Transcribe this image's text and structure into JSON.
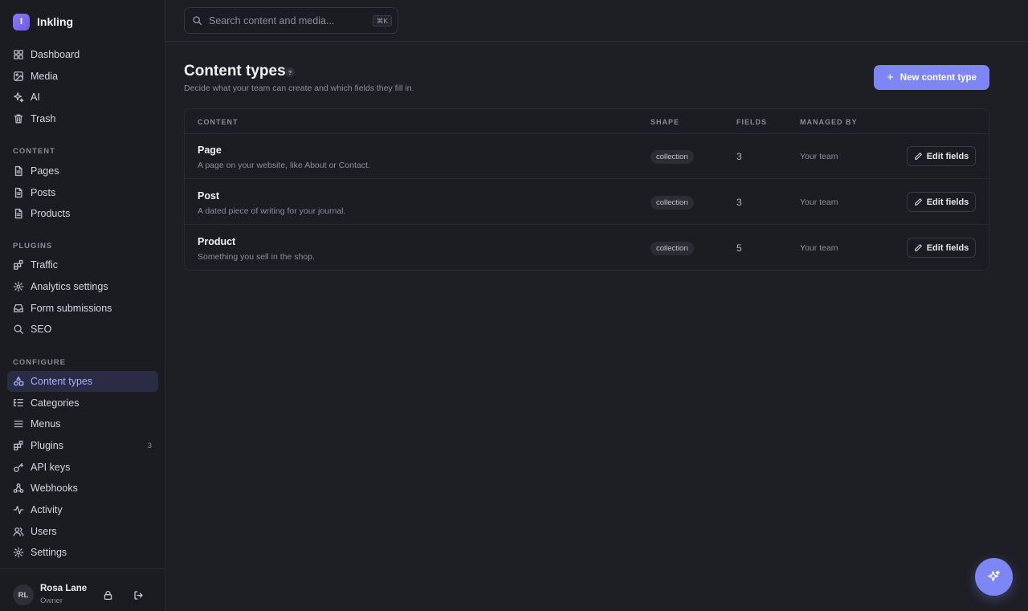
{
  "brand": {
    "initial": "I",
    "name": "Inkling"
  },
  "search": {
    "placeholder": "Search content and media...",
    "shortcut": "⌘K"
  },
  "sidebar": {
    "main": [
      {
        "label": "Dashboard",
        "icon": "grid-icon"
      },
      {
        "label": "Media",
        "icon": "image-icon"
      },
      {
        "label": "AI",
        "icon": "sparkle-icon"
      },
      {
        "label": "Trash",
        "icon": "trash-icon"
      }
    ],
    "content_label": "CONTENT",
    "content": [
      {
        "label": "Pages",
        "icon": "document-icon"
      },
      {
        "label": "Posts",
        "icon": "document-icon"
      },
      {
        "label": "Products",
        "icon": "document-icon"
      }
    ],
    "plugins_label": "PLUGINS",
    "plugins": [
      {
        "label": "Traffic",
        "icon": "blocks-icon"
      },
      {
        "label": "Analytics settings",
        "icon": "gear-icon"
      },
      {
        "label": "Form submissions",
        "icon": "inbox-icon"
      },
      {
        "label": "SEO",
        "icon": "search-icon"
      }
    ],
    "configure_label": "CONFIGURE",
    "configure": [
      {
        "label": "Content types",
        "icon": "shapes-icon",
        "active": true
      },
      {
        "label": "Categories",
        "icon": "list-tree-icon"
      },
      {
        "label": "Menus",
        "icon": "menu-icon"
      },
      {
        "label": "Plugins",
        "icon": "blocks-icon",
        "count": "3"
      },
      {
        "label": "API keys",
        "icon": "key-icon"
      },
      {
        "label": "Webhooks",
        "icon": "webhook-icon"
      },
      {
        "label": "Activity",
        "icon": "activity-icon"
      },
      {
        "label": "Users",
        "icon": "users-icon"
      },
      {
        "label": "Settings",
        "icon": "gear-icon"
      }
    ]
  },
  "user": {
    "initials": "RL",
    "name": "Rosa Lane",
    "role": "Owner"
  },
  "page": {
    "title": "Content types",
    "help": "?",
    "subtitle": "Decide what your team can create and which fields they fill in.",
    "new_button": "New content type"
  },
  "table": {
    "headers": {
      "content": "CONTENT",
      "shape": "SHAPE",
      "fields": "FIELDS",
      "managed": "MANAGED BY"
    },
    "rows": [
      {
        "name": "Page",
        "description": "A page on your website, like About or Contact.",
        "shape": "collection",
        "fields": "3",
        "managed_by": "Your team",
        "action": "Edit fields"
      },
      {
        "name": "Post",
        "description": "A dated piece of writing for your journal.",
        "shape": "collection",
        "fields": "3",
        "managed_by": "Your team",
        "action": "Edit fields"
      },
      {
        "name": "Product",
        "description": "Something you sell in the shop.",
        "shape": "collection",
        "fields": "5",
        "managed_by": "Your team",
        "action": "Edit fields"
      }
    ]
  },
  "colors": {
    "accent": "#7e86f5",
    "active_bg": "#2a2b45",
    "background": "#1e1f25"
  }
}
